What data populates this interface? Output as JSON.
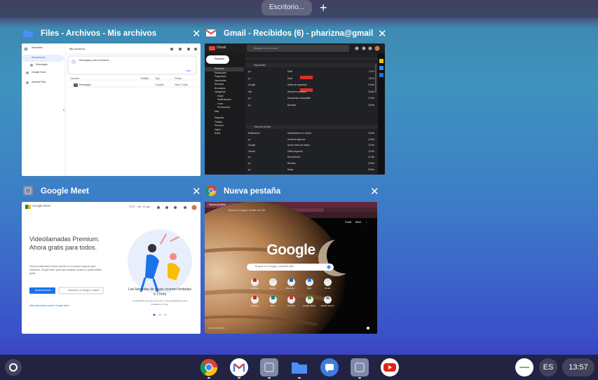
{
  "top": {
    "desk_label": "Escritorio...",
    "add_desk": "+"
  },
  "windows": {
    "files": {
      "title": "Files - Archivos - Mis archivos",
      "sidebar_items": [
        "Recientes",
        "Mis archivos",
        "Descargas",
        "Google Drive",
        "Android Files"
      ],
      "header": "Mis archivos",
      "banner": "Descargas y otros archivos",
      "banner_btn": "Listo",
      "cols": [
        "Nombre",
        "Tamaño",
        "Tipo",
        "Fecha"
      ],
      "row_name": "Descargas",
      "row_type": "Carpeta",
      "row_date": "Hace 2 días"
    },
    "gmail": {
      "title": "Gmail - Recibidos (6) - pharizna@gmail.c...",
      "logo": "Gmail",
      "search": "Buscar en el correo",
      "compose": "Redactar",
      "nav": [
        "Recibidos",
        "Destacados",
        "Pospuestos",
        "Importantes",
        "Enviados",
        "Borradores",
        "Categorías",
        "Social",
        "Notificaciones",
        "Foros",
        "Promociones",
        "Más"
      ],
      "nav_labels": [
        "Etiquetas",
        "Trabajo",
        "Personal",
        "Viajes",
        "Notas"
      ],
      "section1": "Importantes",
      "section2": "Todos los demás",
      "rows1": [
        {
          "from": "yo",
          "subj": "Draft",
          "date": "12:01"
        },
        {
          "from": "yo",
          "subj": "Draft",
          "date": "09:15"
        },
        {
          "from": "Google",
          "subj": "Alerta de seguridad",
          "date": "19 feb"
        },
        {
          "from": "info",
          "subj": "Resumen semanal",
          "date": "18 feb"
        },
        {
          "from": "yo",
          "subj": "Documento compartido",
          "date": "17 feb"
        },
        {
          "from": "yo",
          "subj": "Borrador",
          "date": "16 feb"
        }
      ],
      "rows2": [
        {
          "from": "Notificación",
          "subj": "Actualización de cuenta",
          "date": "15 feb"
        },
        {
          "from": "yo",
          "subj": "Archivos adjuntos",
          "date": "14 feb"
        },
        {
          "from": "Google",
          "subj": "Nuevo inicio de sesión",
          "date": "13 feb"
        },
        {
          "from": "Tienda",
          "subj": "Oferta especial",
          "date": "12 feb"
        },
        {
          "from": "yo",
          "subj": "Recordatorio",
          "date": "11 feb"
        },
        {
          "from": "yo",
          "subj": "Reunión",
          "date": "10 feb"
        },
        {
          "from": "yo",
          "subj": "Notas",
          "date": "09 feb"
        }
      ]
    },
    "meet": {
      "title": "Google Meet",
      "logo": "Google Meet",
      "time": "10:57 · mié, 19 ago",
      "headline": "Videollamadas Premium. Ahora gratis para todos.",
      "subtext": "Hemos rediseñado nuestro servicio de reuniones seguras para empresas, Google Meet, para que cualquier usuario lo pueda utilizar gratis.",
      "btn_new": "Nueva reunión",
      "btn_code": "Introduce un código o enlace",
      "link": "Más información sobre Google Meet",
      "caption": "Las llamadas de grupo ocurren limitadas a 1 hora",
      "caption_small": "Las llamadas de grupo entre tres o más participantes están limitadas a 1 hora."
    },
    "ntab": {
      "title": "Nueva pestaña",
      "tab_label": "Nueva pestaña",
      "address": "Buscar en Google o escribir una URL",
      "logo": "Google",
      "search": "Buscar en Google o escribir URL",
      "links": [
        "Gmail",
        "Meet",
        "Drive"
      ],
      "shortcuts": [
        {
          "label": "Noticias",
          "color": "#c62828"
        },
        {
          "label": "Gmail",
          "color": "#e0e0e0"
        },
        {
          "label": "Bolsa de...",
          "color": "#1565c0"
        },
        {
          "label": "Files",
          "color": "#1e88e5"
        },
        {
          "label": "Gmail",
          "color": "#e0e0e0"
        },
        {
          "label": "Noticias",
          "color": "#c62828"
        },
        {
          "label": "Meet",
          "color": "#00897b"
        },
        {
          "label": "YouTube",
          "color": "#d32f2f"
        },
        {
          "label": "Google Maps",
          "color": "#43a047"
        },
        {
          "label": "Añadir acceso",
          "color": "#9e9e9e"
        }
      ],
      "footer": "Foto de la NASA"
    }
  },
  "shelf": {
    "apps": [
      {
        "name": "chrome-app",
        "color": "#4285f4"
      },
      {
        "name": "gmail-app",
        "color": "#ffffff"
      },
      {
        "name": "meet-app",
        "color": "#7e8aa8"
      },
      {
        "name": "files-app",
        "color": "#1e88e5"
      },
      {
        "name": "messages-app",
        "color": "#3c7ce0"
      },
      {
        "name": "generic-app",
        "color": "#7e8aa8"
      },
      {
        "name": "youtube-app",
        "color": "#e62117"
      }
    ],
    "lang": "ES",
    "time": "13:57"
  }
}
